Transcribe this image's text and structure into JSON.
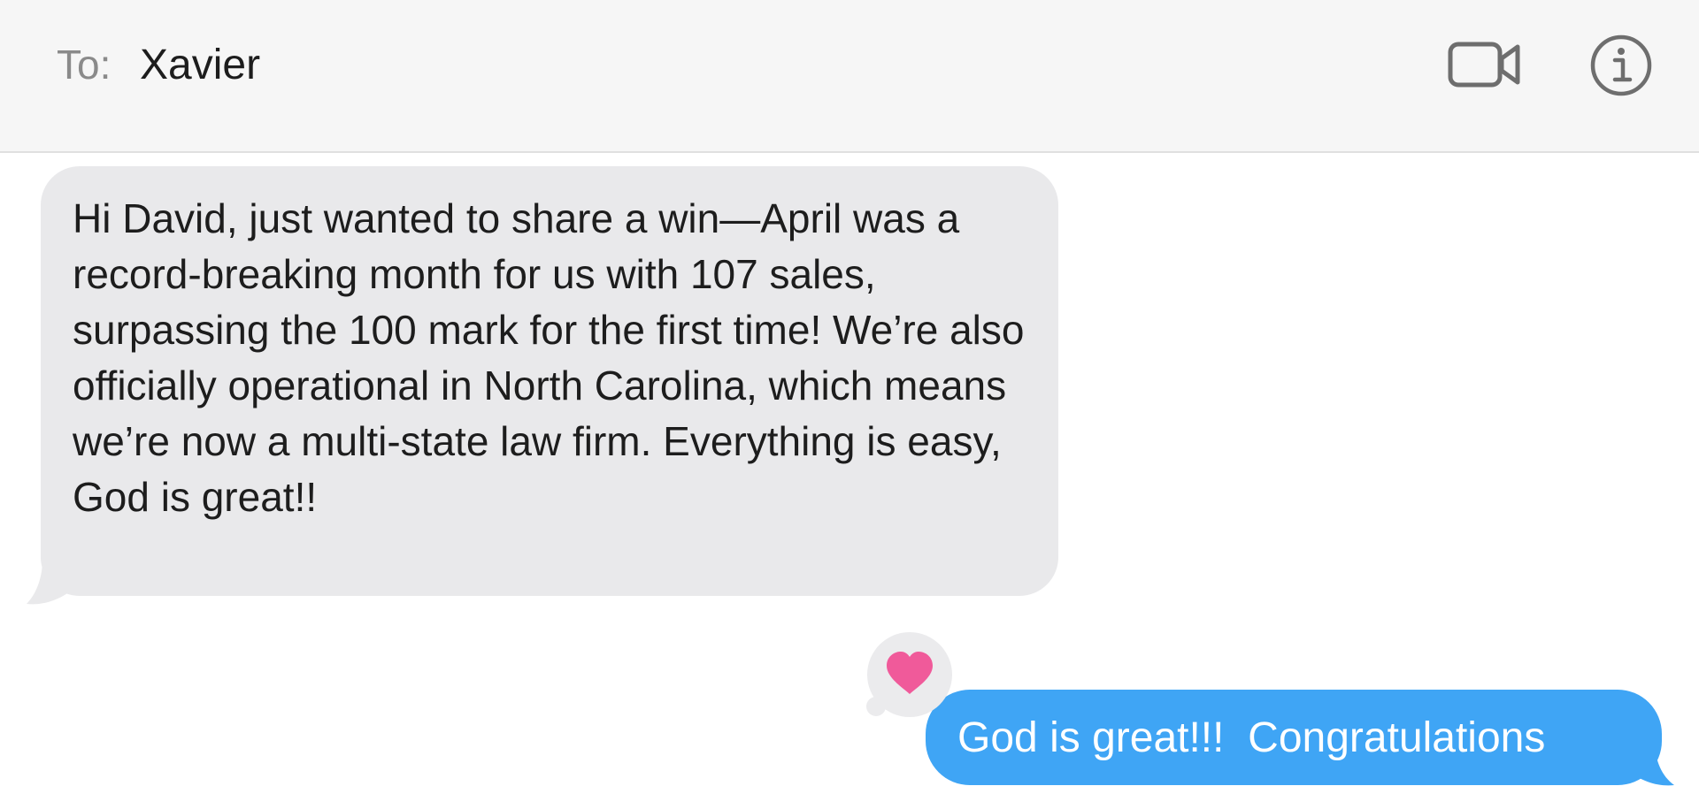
{
  "header": {
    "to_label": "To:",
    "recipient": "Xavier",
    "icons": [
      "video-camera-icon",
      "info-icon"
    ]
  },
  "thread": {
    "messages": [
      {
        "direction": "incoming",
        "text": "Hi David, just wanted to share a win—April was a record-breaking month for us with 107 sales, surpassing the 100 mark for the first time! We’re also officially operational in North Carolina, which means we’re now a multi-state law firm. Everything is easy, God is great!!"
      },
      {
        "direction": "outgoing",
        "text": "God is great!!!  Congratulations",
        "tapback": "heart-icon"
      }
    ]
  },
  "colors": {
    "header_bg": "#f6f6f6",
    "incoming_bubble": "#e9e9eb",
    "outgoing_bubble": "#3fa5f5",
    "heart": "#f05a9a",
    "icon_gray": "#6e6e6e"
  }
}
